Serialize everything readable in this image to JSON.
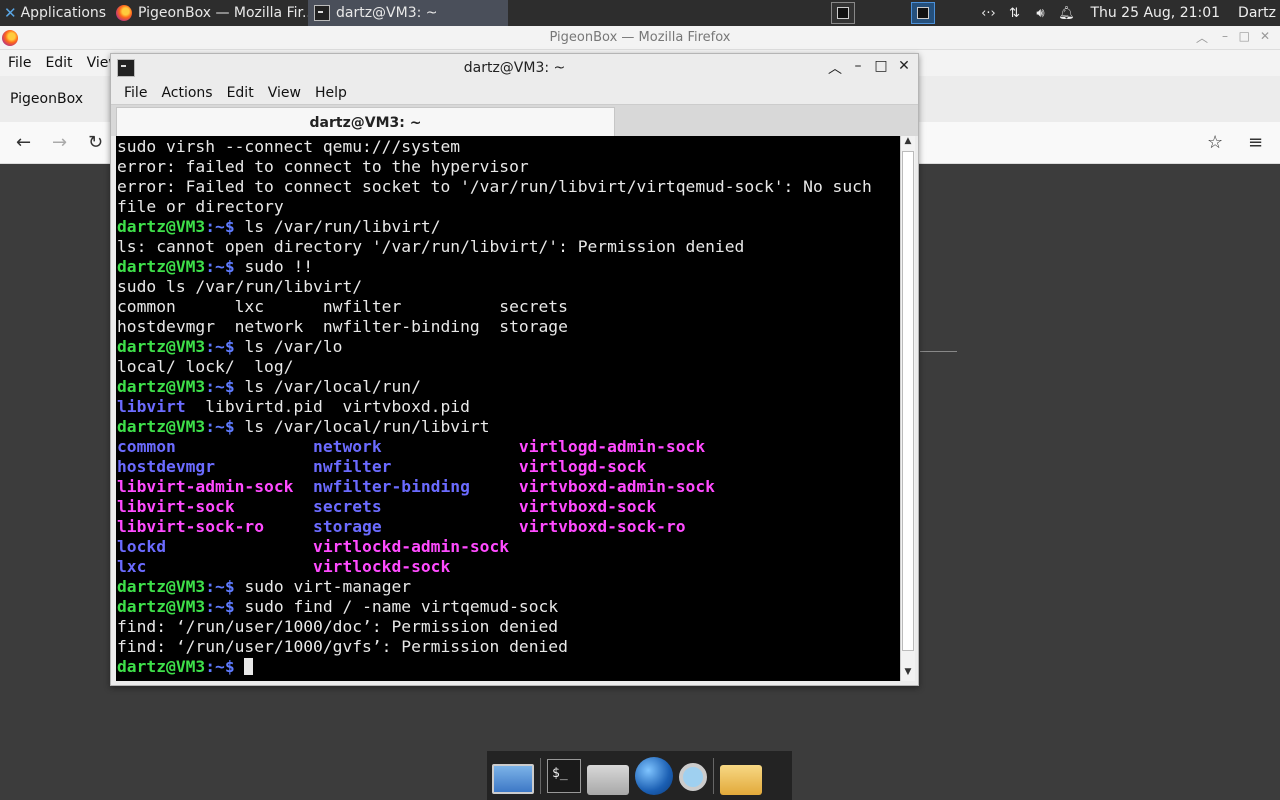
{
  "top_panel": {
    "applications_label": "Applications",
    "tasks": [
      {
        "title": "PigeonBox — Mozilla Fir..."
      },
      {
        "title": "dartz@VM3: ~"
      }
    ],
    "clock": "Thu 25 Aug, 21:01",
    "user": "Dartz"
  },
  "firefox": {
    "window_title": "PigeonBox — Mozilla Firefox",
    "menu": [
      "File",
      "Edit",
      "View"
    ],
    "tab_title": "PigeonBox"
  },
  "terminal": {
    "window_title": "dartz@VM3: ~",
    "menu": [
      "File",
      "Actions",
      "Edit",
      "View",
      "Help"
    ],
    "tab_title": "dartz@VM3: ~",
    "prompt_user": "dartz@VM3",
    "prompt_path": ":~$",
    "lines": [
      {
        "type": "out",
        "text": "sudo virsh --connect qemu:///system"
      },
      {
        "type": "out",
        "text": "error: failed to connect to the hypervisor"
      },
      {
        "type": "out",
        "text": "error: Failed to connect socket to '/var/run/libvirt/virtqemud-sock': No such"
      },
      {
        "type": "out",
        "text": "file or directory"
      },
      {
        "type": "cmd",
        "text": " ls /var/run/libvirt/"
      },
      {
        "type": "out",
        "text": "ls: cannot open directory '/var/run/libvirt/': Permission denied"
      },
      {
        "type": "cmd",
        "text": " sudo !!"
      },
      {
        "type": "out",
        "text": "sudo ls /var/run/libvirt/"
      },
      {
        "type": "out",
        "text": "common      lxc      nwfilter          secrets"
      },
      {
        "type": "out",
        "text": "hostdevmgr  network  nwfilter-binding  storage"
      },
      {
        "type": "cmd",
        "text": " ls /var/lo"
      },
      {
        "type": "out",
        "text": "local/ lock/  log/"
      },
      {
        "type": "cmd",
        "text": " ls /var/local/run/"
      },
      {
        "type": "mixed",
        "parts": [
          {
            "cls": "c-dir",
            "text": "libvirt"
          },
          {
            "cls": "",
            "text": "  libvirtd.pid  virtvboxd.pid"
          }
        ]
      },
      {
        "type": "cmd",
        "text": " ls /var/local/run/libvirt"
      },
      {
        "type": "mixed",
        "parts": [
          {
            "cls": "c-dir",
            "text": "common              network              "
          },
          {
            "cls": "c-sock",
            "text": "virtlogd-admin-sock"
          }
        ]
      },
      {
        "type": "mixed",
        "parts": [
          {
            "cls": "c-dir",
            "text": "hostdevmgr          nwfilter             "
          },
          {
            "cls": "c-sock",
            "text": "virtlogd-sock"
          }
        ]
      },
      {
        "type": "mixed",
        "parts": [
          {
            "cls": "c-sock",
            "text": "libvirt-admin-sock  "
          },
          {
            "cls": "c-dir",
            "text": "nwfilter-binding     "
          },
          {
            "cls": "c-sock",
            "text": "virtvboxd-admin-sock"
          }
        ]
      },
      {
        "type": "mixed",
        "parts": [
          {
            "cls": "c-sock",
            "text": "libvirt-sock        "
          },
          {
            "cls": "c-dir",
            "text": "secrets              "
          },
          {
            "cls": "c-sock",
            "text": "virtvboxd-sock"
          }
        ]
      },
      {
        "type": "mixed",
        "parts": [
          {
            "cls": "c-sock",
            "text": "libvirt-sock-ro     "
          },
          {
            "cls": "c-dir",
            "text": "storage              "
          },
          {
            "cls": "c-sock",
            "text": "virtvboxd-sock-ro"
          }
        ]
      },
      {
        "type": "mixed",
        "parts": [
          {
            "cls": "c-dir",
            "text": "lockd               "
          },
          {
            "cls": "c-sock",
            "text": "virtlockd-admin-sock"
          }
        ]
      },
      {
        "type": "mixed",
        "parts": [
          {
            "cls": "c-dir",
            "text": "lxc                 "
          },
          {
            "cls": "c-sock",
            "text": "virtlockd-sock"
          }
        ]
      },
      {
        "type": "cmd",
        "text": " sudo virt-manager"
      },
      {
        "type": "cmd",
        "text": " sudo find / -name virtqemud-sock"
      },
      {
        "type": "out",
        "text": "find: ‘/run/user/1000/doc’: Permission denied"
      },
      {
        "type": "out",
        "text": "find: ‘/run/user/1000/gvfs’: Permission denied"
      },
      {
        "type": "prompt",
        "text": " "
      }
    ]
  },
  "dock": {
    "items": [
      "desktop",
      "terminal",
      "home-folder",
      "web-browser",
      "search",
      "files"
    ],
    "terminal_glyph": "$_"
  },
  "colors": {
    "prompt_user": "#3ee04a",
    "directory": "#6b6bff",
    "socket": "#ff4bff",
    "terminal_bg": "#000000"
  }
}
